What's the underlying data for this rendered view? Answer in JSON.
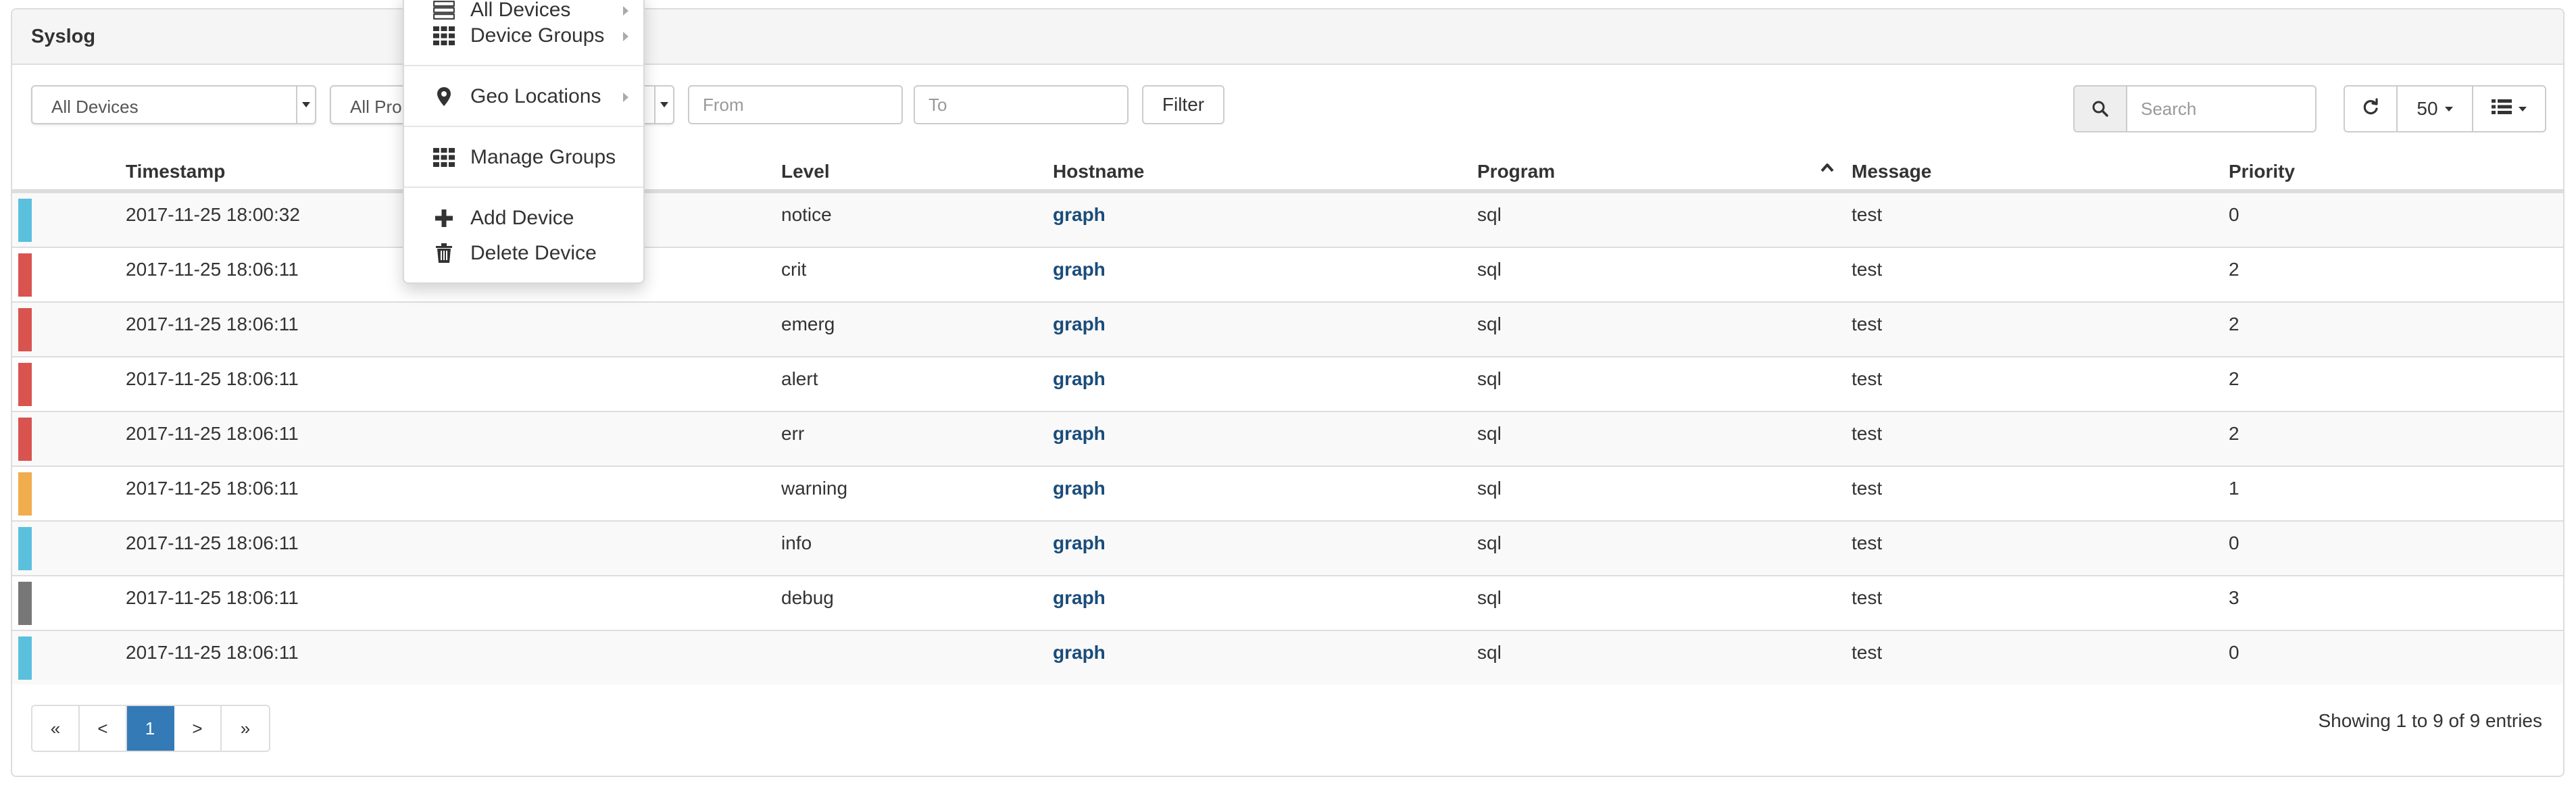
{
  "panel": {
    "title": "Syslog"
  },
  "toolbar": {
    "device_select": "All Devices",
    "program_select": "All Pro",
    "from_placeholder": "From",
    "to_placeholder": "To",
    "filter_label": "Filter",
    "search_placeholder": "Search",
    "page_size": "50"
  },
  "table": {
    "headers": {
      "timestamp": "Timestamp",
      "level": "Level",
      "hostname": "Hostname",
      "program": "Program",
      "message": "Message",
      "priority": "Priority"
    },
    "rows": [
      {
        "timestamp": "2017-11-25 18:00:32",
        "level": "notice",
        "hostname": "graph",
        "program": "sql",
        "message": "test",
        "priority": "0",
        "color": "#5bc0de"
      },
      {
        "timestamp": "2017-11-25 18:06:11",
        "level": "crit",
        "hostname": "graph",
        "program": "sql",
        "message": "test",
        "priority": "2",
        "color": "#d9534f"
      },
      {
        "timestamp": "2017-11-25 18:06:11",
        "level": "emerg",
        "hostname": "graph",
        "program": "sql",
        "message": "test",
        "priority": "2",
        "color": "#d9534f"
      },
      {
        "timestamp": "2017-11-25 18:06:11",
        "level": "alert",
        "hostname": "graph",
        "program": "sql",
        "message": "test",
        "priority": "2",
        "color": "#d9534f"
      },
      {
        "timestamp": "2017-11-25 18:06:11",
        "level": "err",
        "hostname": "graph",
        "program": "sql",
        "message": "test",
        "priority": "2",
        "color": "#d9534f"
      },
      {
        "timestamp": "2017-11-25 18:06:11",
        "level": "warning",
        "hostname": "graph",
        "program": "sql",
        "message": "test",
        "priority": "1",
        "color": "#f0ad4e"
      },
      {
        "timestamp": "2017-11-25 18:06:11",
        "level": "info",
        "hostname": "graph",
        "program": "sql",
        "message": "test",
        "priority": "0",
        "color": "#5bc0de"
      },
      {
        "timestamp": "2017-11-25 18:06:11",
        "level": "debug",
        "hostname": "graph",
        "program": "sql",
        "message": "test",
        "priority": "3",
        "color": "#777777"
      },
      {
        "timestamp": "2017-11-25 18:06:11",
        "level": "",
        "hostname": "graph",
        "program": "sql",
        "message": "test",
        "priority": "0",
        "color": "#5bc0de"
      }
    ]
  },
  "pagination": {
    "first": "«",
    "prev": "<",
    "current": "1",
    "next": ">",
    "last": "»",
    "summary": "Showing 1 to 9 of 9 entries"
  },
  "menu": {
    "items": [
      {
        "label": "All Devices",
        "icon": "server-icon",
        "submenu": true
      },
      {
        "label": "Device Groups",
        "icon": "grid-icon",
        "submenu": true
      },
      {
        "label": "Geo Locations",
        "icon": "map-marker-icon",
        "submenu": true
      },
      {
        "label": "Manage Groups",
        "icon": "grid-icon",
        "submenu": false
      },
      {
        "label": "Add Device",
        "icon": "plus-icon",
        "submenu": false
      },
      {
        "label": "Delete Device",
        "icon": "trash-icon",
        "submenu": false
      }
    ]
  },
  "colors": {
    "accent": "#337ab7",
    "hostname_link": "#1a4c7a",
    "level_info": "#5bc0de",
    "level_error": "#d9534f",
    "level_warning": "#f0ad4e",
    "level_debug": "#777777"
  }
}
